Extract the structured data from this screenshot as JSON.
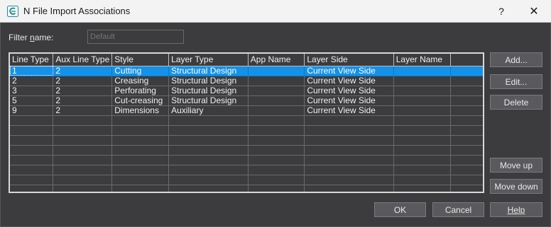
{
  "window": {
    "title": "N File Import Associations",
    "help_glyph": "?",
    "close_glyph": "✕"
  },
  "filter": {
    "label": "Filter name:",
    "value": "",
    "placeholder": "Default"
  },
  "table": {
    "columns": [
      "Line Type",
      "Aux Line Type",
      "Style",
      "Layer Type",
      "App Name",
      "Layer Side",
      "Layer Name",
      ""
    ],
    "rows": [
      [
        "1",
        "2",
        "Cutting",
        "Structural Design",
        "",
        "Current View Side",
        "",
        ""
      ],
      [
        "2",
        "2",
        "Creasing",
        "Structural Design",
        "",
        "Current View Side",
        "",
        ""
      ],
      [
        "3",
        "2",
        "Perforating",
        "Structural Design",
        "",
        "Current View Side",
        "",
        ""
      ],
      [
        "5",
        "2",
        "Cut-creasing",
        "Structural Design",
        "",
        "Current View Side",
        "",
        ""
      ],
      [
        "9",
        "2",
        "Dimensions",
        "Auxiliary",
        "",
        "Current View Side",
        "",
        ""
      ]
    ],
    "selected_row": 0,
    "empty_rows": 8
  },
  "buttons": {
    "add": "Add...",
    "edit": "Edit...",
    "delete": "Delete",
    "move_up": "Move up",
    "move_down": "Move down",
    "ok": "OK",
    "cancel": "Cancel",
    "help": "Help"
  },
  "colors": {
    "background": "#3c3c3f",
    "selection": "#1591e8",
    "titlebar": "#f3f3f3",
    "button": "#5a5a5e"
  },
  "icons": {
    "app": "app-logo-icon"
  }
}
